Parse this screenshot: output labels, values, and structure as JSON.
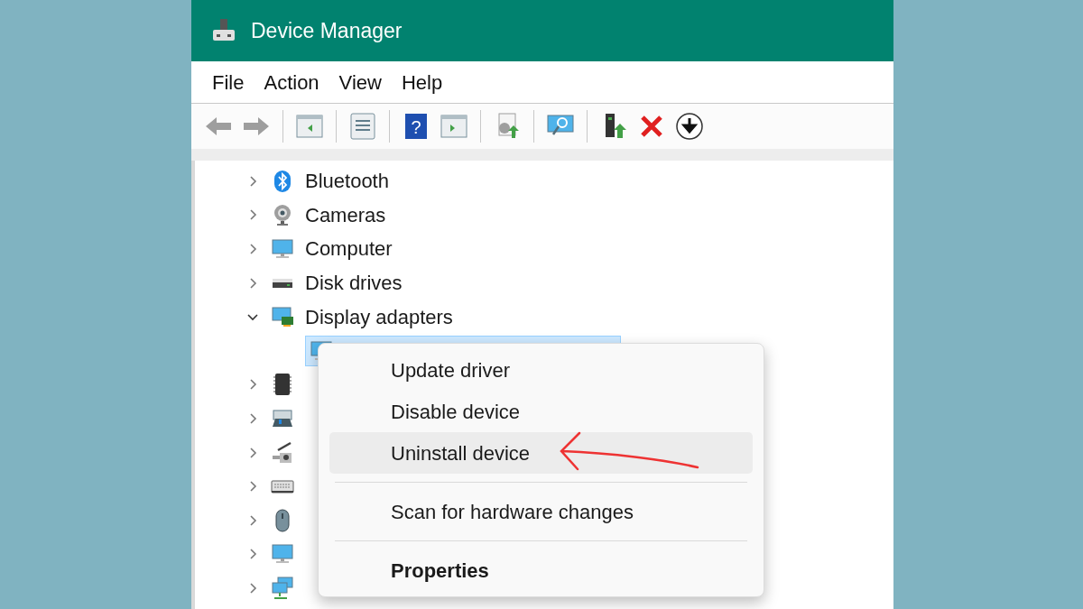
{
  "window": {
    "title": "Device Manager"
  },
  "menu_bar": [
    "File",
    "Action",
    "View",
    "Help"
  ],
  "toolbar": {
    "help_glyph": "?"
  },
  "tree": [
    {
      "label": "Bluetooth",
      "kind": "bluetooth",
      "expanded": false
    },
    {
      "label": "Cameras",
      "kind": "camera",
      "expanded": false
    },
    {
      "label": "Computer",
      "kind": "monitor",
      "expanded": false
    },
    {
      "label": "Disk drives",
      "kind": "disk",
      "expanded": false
    },
    {
      "label": "Display adapters",
      "kind": "display",
      "expanded": true,
      "children": [
        {
          "kind": "monitor",
          "selected": true
        }
      ]
    },
    {
      "kind": "chip",
      "expanded": false
    },
    {
      "kind": "gamepad",
      "expanded": false
    },
    {
      "kind": "scanner",
      "expanded": false
    },
    {
      "kind": "keyboard",
      "expanded": false
    },
    {
      "kind": "mouse",
      "expanded": false
    },
    {
      "kind": "monitor",
      "expanded": false
    },
    {
      "kind": "network",
      "expanded": false
    }
  ],
  "context_menu": [
    {
      "label": "Update driver",
      "selected": false,
      "default": false,
      "separator_before": false
    },
    {
      "label": "Disable device",
      "selected": false,
      "default": false,
      "separator_before": false
    },
    {
      "label": "Uninstall device",
      "selected": true,
      "default": false,
      "separator_before": false
    },
    {
      "label": "Scan for hardware changes",
      "selected": false,
      "default": false,
      "separator_before": true
    },
    {
      "label": "Properties",
      "selected": false,
      "default": true,
      "separator_before": true
    }
  ]
}
